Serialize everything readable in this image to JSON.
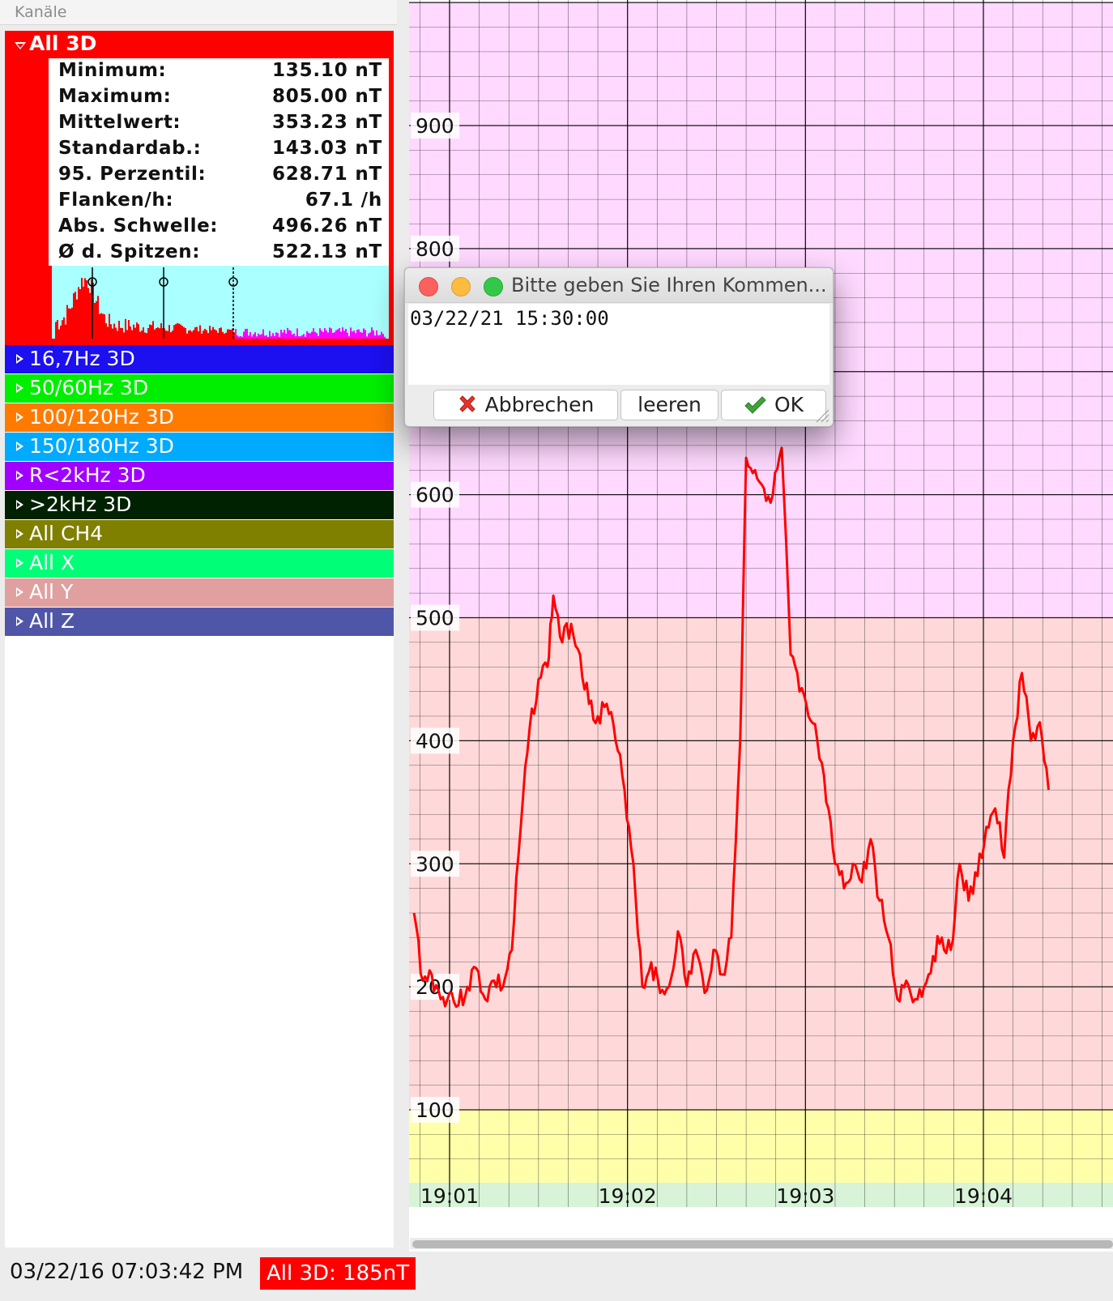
{
  "panel": {
    "title": "Kanäle"
  },
  "all3d": {
    "label": "All 3D",
    "color": "#ff0000",
    "stats": [
      {
        "label": "Minimum:",
        "value": "135.10 nT"
      },
      {
        "label": "Maximum:",
        "value": "805.00 nT"
      },
      {
        "label": "Mittelwert:",
        "value": "353.23 nT"
      },
      {
        "label": "Standardab.:",
        "value": "143.03 nT"
      },
      {
        "label": "95. Perzentil:",
        "value": "628.71 nT"
      },
      {
        "label": "Flanken/h:",
        "value": "67.1 /h"
      },
      {
        "label": "Abs. Schwelle:",
        "value": "496.26 nT"
      },
      {
        "label": "Ø d. Spitzen:",
        "value": "522.13 nT"
      }
    ]
  },
  "channels": [
    {
      "label": "16,7Hz 3D",
      "color": "#1c0ff0"
    },
    {
      "label": "50/60Hz 3D",
      "color": "#00ee00"
    },
    {
      "label": "100/120Hz 3D",
      "color": "#ff7b00"
    },
    {
      "label": "150/180Hz 3D",
      "color": "#00aaff"
    },
    {
      "label": "R<2kHz 3D",
      "color": "#a000ff"
    },
    {
      "label": ">2kHz 3D",
      "color": "#002200"
    },
    {
      "label": "All CH4",
      "color": "#7f7f00"
    },
    {
      "label": "All X",
      "color": "#00ff77"
    },
    {
      "label": "All Y",
      "color": "#e0a0a0"
    },
    {
      "label": "All Z",
      "color": "#4f56a8"
    }
  ],
  "status": {
    "datetime": "03/22/16 07:03:42 PM",
    "badge": "All 3D: 185nT"
  },
  "dialog": {
    "title": "Bitte geben Sie Ihren Kommen...",
    "text": "03/22/21 15:30:00",
    "cancel_label": "Abbrechen",
    "clear_label": "leeren",
    "ok_label": "OK"
  },
  "chart_data": {
    "type": "line",
    "y_ticks": [
      "900",
      "800",
      "600",
      "500",
      "400",
      "300",
      "200",
      "100",
      "300"
    ],
    "x_ticks": [
      "19:01",
      "19:02",
      "19:03",
      "19:04"
    ],
    "ylim": [
      20,
      1000
    ],
    "xlim": [
      "19:00:48",
      "19:04:52"
    ],
    "bands": [
      {
        "from": 500,
        "to": 1000,
        "color": "#ffd9ff"
      },
      {
        "from": 100,
        "to": 500,
        "color": "#ffd9d9"
      },
      {
        "from": 20,
        "to": 100,
        "color": "#ffffaa"
      }
    ],
    "series": [
      {
        "color": "#ff0000",
        "points": [
          [
            "19:00:48",
            260
          ],
          [
            "19:00:51",
            205
          ],
          [
            "19:00:54",
            210
          ],
          [
            "19:00:57",
            190
          ],
          [
            "19:01:00",
            195
          ],
          [
            "19:01:03",
            185
          ],
          [
            "19:01:06",
            200
          ],
          [
            "19:01:09",
            215
          ],
          [
            "19:01:12",
            190
          ],
          [
            "19:01:15",
            205
          ],
          [
            "19:01:18",
            200
          ],
          [
            "19:01:21",
            230
          ],
          [
            "19:01:24",
            330
          ],
          [
            "19:01:27",
            410
          ],
          [
            "19:01:30",
            450
          ],
          [
            "19:01:33",
            460
          ],
          [
            "19:01:35",
            518
          ],
          [
            "19:01:38",
            480
          ],
          [
            "19:01:41",
            495
          ],
          [
            "19:01:44",
            470
          ],
          [
            "19:01:47",
            430
          ],
          [
            "19:01:50",
            420
          ],
          [
            "19:01:53",
            430
          ],
          [
            "19:01:56",
            400
          ],
          [
            "19:01:59",
            360
          ],
          [
            "19:02:02",
            300
          ],
          [
            "19:02:05",
            200
          ],
          [
            "19:02:08",
            220
          ],
          [
            "19:02:11",
            195
          ],
          [
            "19:02:14",
            200
          ],
          [
            "19:02:17",
            245
          ],
          [
            "19:02:20",
            200
          ],
          [
            "19:02:23",
            230
          ],
          [
            "19:02:26",
            195
          ],
          [
            "19:02:29",
            230
          ],
          [
            "19:02:32",
            210
          ],
          [
            "19:02:35",
            240
          ],
          [
            "19:02:38",
            400
          ],
          [
            "19:02:40",
            630
          ],
          [
            "19:02:43",
            620
          ],
          [
            "19:02:46",
            605
          ],
          [
            "19:02:49",
            600
          ],
          [
            "19:02:52",
            638
          ],
          [
            "19:02:55",
            470
          ],
          [
            "19:02:58",
            440
          ],
          [
            "19:03:01",
            420
          ],
          [
            "19:03:04",
            400
          ],
          [
            "19:03:07",
            350
          ],
          [
            "19:03:10",
            300
          ],
          [
            "19:03:13",
            280
          ],
          [
            "19:03:16",
            300
          ],
          [
            "19:03:19",
            285
          ],
          [
            "19:03:22",
            320
          ],
          [
            "19:03:25",
            270
          ],
          [
            "19:03:28",
            240
          ],
          [
            "19:03:31",
            190
          ],
          [
            "19:03:34",
            205
          ],
          [
            "19:03:37",
            190
          ],
          [
            "19:03:40",
            200
          ],
          [
            "19:03:43",
            225
          ],
          [
            "19:03:46",
            240
          ],
          [
            "19:03:49",
            230
          ],
          [
            "19:03:52",
            300
          ],
          [
            "19:03:55",
            270
          ],
          [
            "19:03:58",
            290
          ],
          [
            "19:04:01",
            330
          ],
          [
            "19:04:04",
            345
          ],
          [
            "19:04:07",
            305
          ],
          [
            "19:04:10",
            400
          ],
          [
            "19:04:13",
            455
          ],
          [
            "19:04:16",
            400
          ],
          [
            "19:04:19",
            415
          ],
          [
            "19:04:22",
            360
          ]
        ]
      }
    ],
    "grid": true
  },
  "histogram": {
    "bg": "#aaffff",
    "colors": [
      "#ff0000",
      "#ff00ff"
    ]
  }
}
